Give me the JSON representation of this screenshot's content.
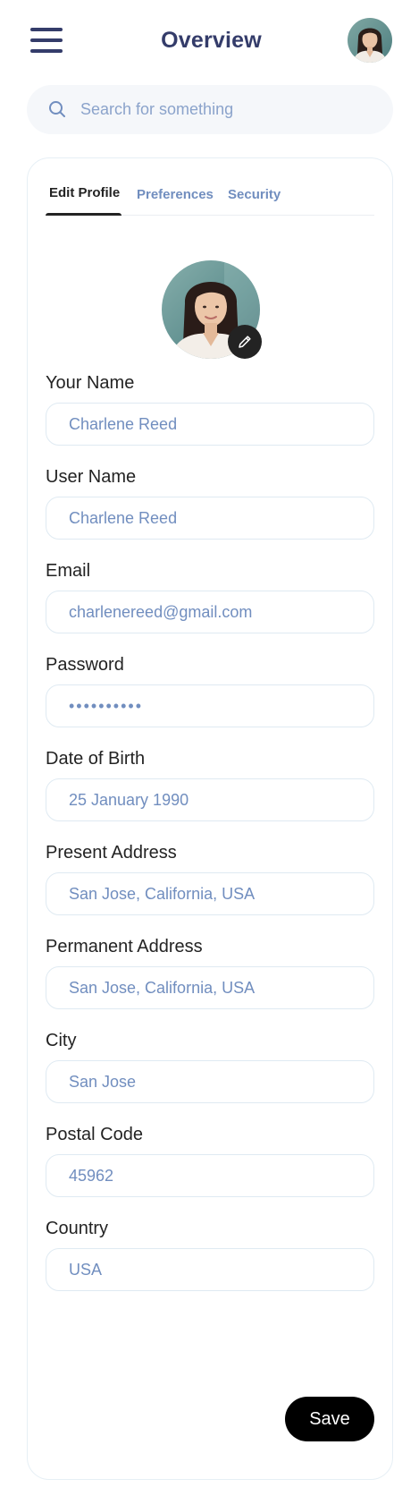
{
  "header": {
    "title": "Overview",
    "menu_icon": "hamburger-menu-icon",
    "avatar_icon": "user-avatar"
  },
  "search": {
    "placeholder": "Search for something",
    "icon": "search-icon"
  },
  "tabs": [
    {
      "label": "Edit Profile",
      "active": true
    },
    {
      "label": "Preferences",
      "active": false
    },
    {
      "label": "Security",
      "active": false
    }
  ],
  "profile": {
    "photo_icon": "profile-photo",
    "edit_icon": "pencil-icon"
  },
  "fields": [
    {
      "label": "Your Name",
      "value": "Charlene Reed"
    },
    {
      "label": "User Name",
      "value": "Charlene Reed"
    },
    {
      "label": "Email",
      "value": "charlenereed@gmail.com"
    },
    {
      "label": "Password",
      "value": "••••••••••"
    },
    {
      "label": "Date of Birth",
      "value": "25 January 1990"
    },
    {
      "label": "Present Address",
      "value": "San Jose, California, USA"
    },
    {
      "label": "Permanent Address",
      "value": "San Jose, California, USA"
    },
    {
      "label": "City",
      "value": "San Jose"
    },
    {
      "label": "Postal Code",
      "value": "45962"
    },
    {
      "label": "Country",
      "value": "USA"
    }
  ],
  "save_label": "Save",
  "colors": {
    "title": "#343c6a",
    "tab_inactive": "#718ebf",
    "input_text": "#718ebf",
    "input_border": "#dfeaf2",
    "search_bg": "#f5f7fa",
    "button_bg": "#000000"
  }
}
